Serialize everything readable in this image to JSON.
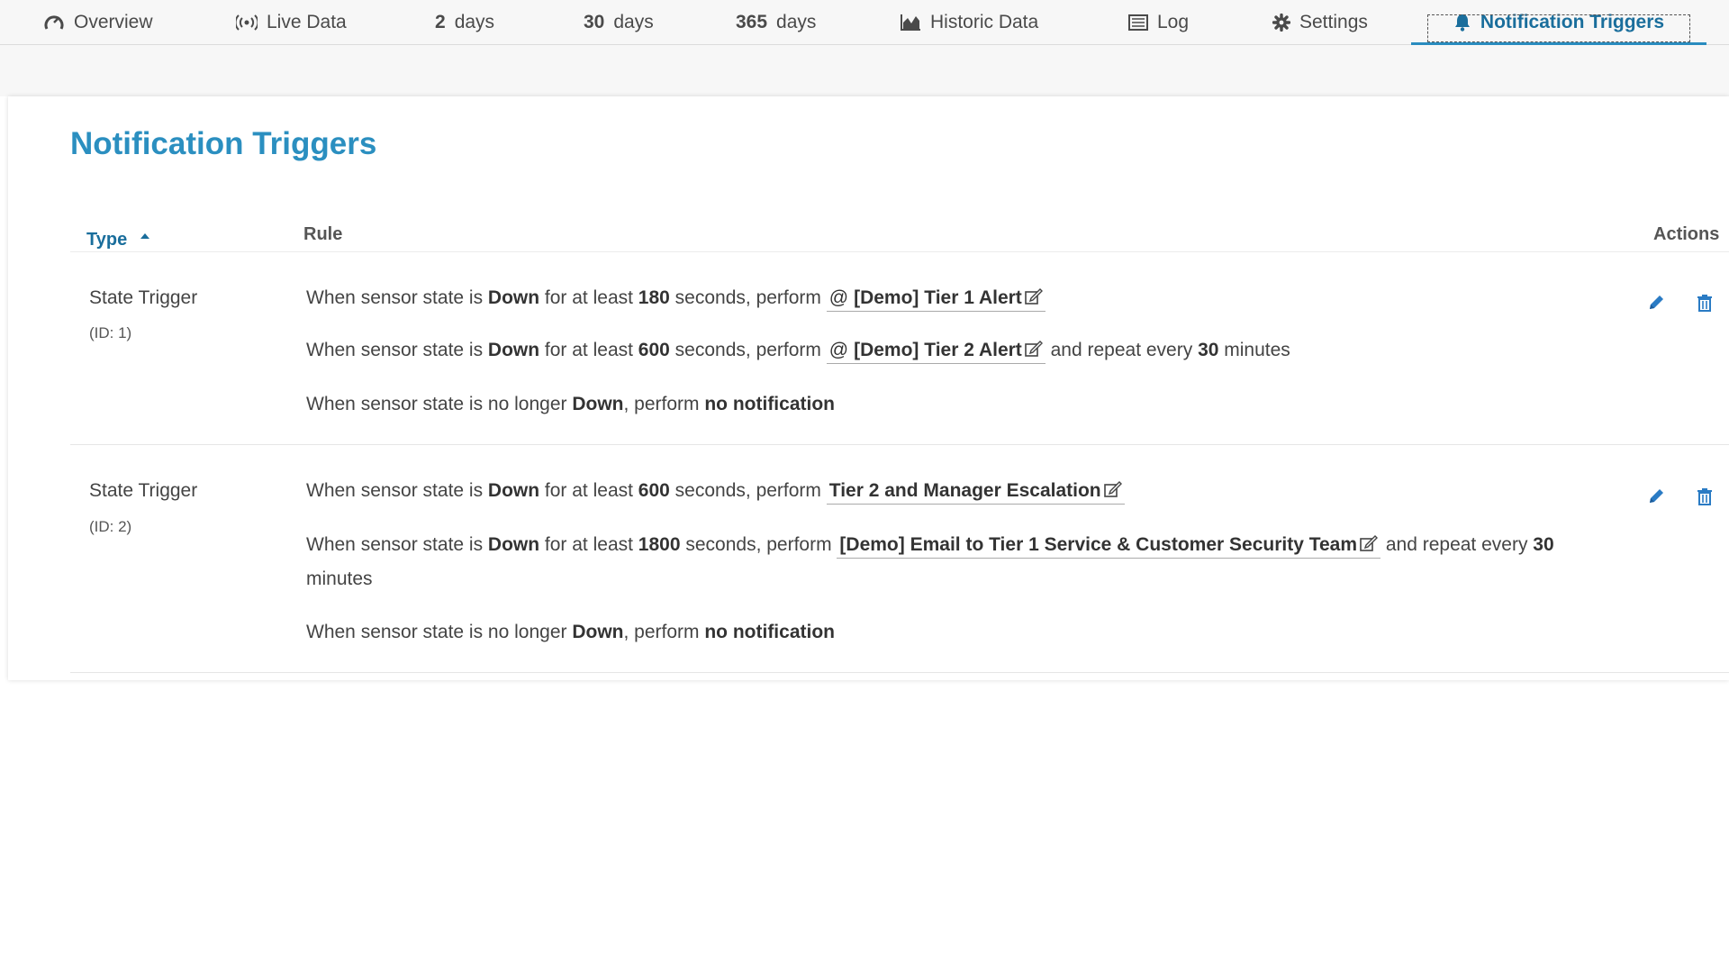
{
  "colors": {
    "accent": "#2b8fc0",
    "icon_blue": "#2a7bc4",
    "text": "#3a3a3a"
  },
  "tabs": {
    "overview": {
      "label": "Overview",
      "icon": "gauge-icon"
    },
    "live_data": {
      "label": "Live Data",
      "icon": "broadcast-icon"
    },
    "days2": {
      "num": "2",
      "label": "days"
    },
    "days30": {
      "num": "30",
      "label": "days"
    },
    "days365": {
      "num": "365",
      "label": "days"
    },
    "historic": {
      "label": "Historic Data",
      "icon": "area-chart-icon"
    },
    "log": {
      "label": "Log",
      "icon": "log-icon"
    },
    "settings": {
      "label": "Settings",
      "icon": "gear-icon"
    },
    "notification_triggers": {
      "label": "Notification Triggers",
      "icon": "bell-icon",
      "active": true
    }
  },
  "page": {
    "title": "Notification Triggers"
  },
  "table": {
    "headers": {
      "type": "Type",
      "rule": "Rule",
      "actions": "Actions"
    },
    "sort": {
      "column": "Type",
      "direction": "ascending"
    },
    "rows": [
      {
        "type": "State Trigger",
        "id": "(ID: 1)",
        "rules": [
          {
            "p1": "When sensor state is ",
            "state": "Down",
            "p2": " for at least ",
            "seconds": "180",
            "p3": " seconds, perform ",
            "at": "@",
            "link": "[Demo] Tier 1 Alert"
          },
          {
            "p1": "When sensor state is ",
            "state": "Down",
            "p2": " for at least ",
            "seconds": "600",
            "p3": " seconds, perform ",
            "at": "@",
            "link": "[Demo] Tier 2 Alert",
            "repeat_pre": " and repeat every ",
            "repeat": "30",
            "repeat_post": " minutes"
          },
          {
            "p1": "When sensor state is no longer ",
            "state": "Down",
            "p2": ", perform ",
            "action": "no notification"
          }
        ]
      },
      {
        "type": "State Trigger",
        "id": "(ID: 2)",
        "rules": [
          {
            "p1": "When sensor state is ",
            "state": "Down",
            "p2": " for at least ",
            "seconds": "600",
            "p3": " seconds, perform ",
            "link": "Tier 2 and Manager Escalation"
          },
          {
            "p1": "When sensor state is ",
            "state": "Down",
            "p2": " for at least ",
            "seconds": "1800",
            "p3": " seconds, perform ",
            "link": "[Demo] Email to Tier 1 Service & Customer Security Team",
            "repeat_pre": " and repeat every ",
            "repeat": "30",
            "repeat_post": " minutes"
          },
          {
            "p1": "When sensor state is no longer ",
            "state": "Down",
            "p2": ", perform ",
            "action": "no notification"
          }
        ]
      }
    ]
  }
}
